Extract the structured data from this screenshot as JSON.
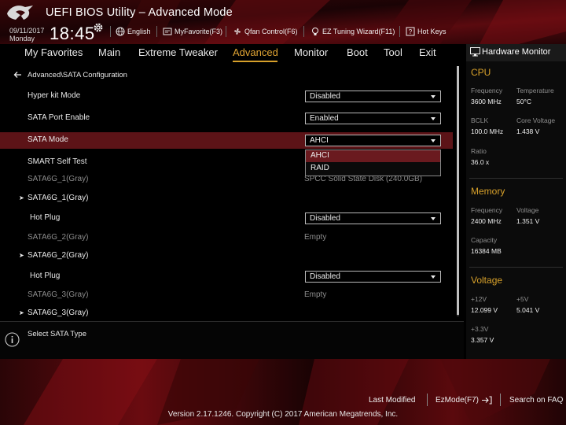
{
  "app": {
    "title": "UEFI BIOS Utility – Advanced Mode",
    "date": "09/11/2017",
    "day": "Monday",
    "time": "18:45"
  },
  "toolbar": {
    "language": "English",
    "myfavorite": "MyFavorite(F3)",
    "qfan": "Qfan Control(F6)",
    "ez_tuning": "EZ Tuning Wizard(F11)",
    "hotkeys": "Hot Keys"
  },
  "nav": {
    "tabs": [
      {
        "label": "My Favorites"
      },
      {
        "label": "Main"
      },
      {
        "label": "Extreme Tweaker"
      },
      {
        "label": "Advanced"
      },
      {
        "label": "Monitor"
      },
      {
        "label": "Boot"
      },
      {
        "label": "Tool"
      },
      {
        "label": "Exit"
      }
    ],
    "active_tab": "Advanced"
  },
  "breadcrumb": "Advanced\\SATA Configuration",
  "settings": {
    "hyper_kit_mode": {
      "label": "Hyper kit Mode",
      "value": "Disabled"
    },
    "sata_port_enable": {
      "label": "SATA Port Enable",
      "value": "Enabled"
    },
    "sata_mode": {
      "label": "SATA Mode",
      "value": "AHCI",
      "options": [
        "AHCI",
        "RAID"
      ]
    },
    "smart_self_test": {
      "label": "SMART Self Test"
    },
    "sata6g_1_info": {
      "label": "SATA6G_1(Gray)",
      "value": "SPCC Solid State Disk (240.0GB)"
    },
    "sata6g_1_sub": {
      "label": "SATA6G_1(Gray)"
    },
    "hot_plug_1": {
      "label": "Hot Plug",
      "value": "Disabled"
    },
    "sata6g_2_info": {
      "label": "SATA6G_2(Gray)",
      "value": "Empty"
    },
    "sata6g_2_sub": {
      "label": "SATA6G_2(Gray)"
    },
    "hot_plug_2": {
      "label": "Hot Plug",
      "value": "Disabled"
    },
    "sata6g_3_info": {
      "label": "SATA6G_3(Gray)",
      "value": "Empty"
    },
    "sata6g_3_sub": {
      "label": "SATA6G_3(Gray)"
    }
  },
  "info": {
    "text": "Select SATA Type"
  },
  "hardware_monitor": {
    "title": "Hardware Monitor",
    "cpu": {
      "heading": "CPU",
      "frequency_label": "Frequency",
      "frequency": "3600 MHz",
      "temperature_label": "Temperature",
      "temperature": "50°C",
      "bclk_label": "BCLK",
      "bclk": "100.0 MHz",
      "core_voltage_label": "Core Voltage",
      "core_voltage": "1.438 V",
      "ratio_label": "Ratio",
      "ratio": "36.0 x"
    },
    "memory": {
      "heading": "Memory",
      "frequency_label": "Frequency",
      "frequency": "2400 MHz",
      "voltage_label": "Voltage",
      "voltage": "1.351 V",
      "capacity_label": "Capacity",
      "capacity": "16384 MB"
    },
    "voltage": {
      "heading": "Voltage",
      "v12_label": "+12V",
      "v12": "12.099 V",
      "v5_label": "+5V",
      "v5": "5.041 V",
      "v33_label": "+3.3V",
      "v33": "3.357 V"
    }
  },
  "footer": {
    "last_modified": "Last Modified",
    "ezmode": "EzMode(F7)",
    "search": "Search on FAQ",
    "version": "Version 2.17.1246. Copyright (C) 2017 American Megatrends, Inc."
  },
  "colors": {
    "accent": "#d7a02a",
    "selected_row": "#5c1317",
    "background": "#000000"
  },
  "icons": [
    "rog-logo-icon",
    "gear-icon",
    "globe-icon",
    "favorite-icon",
    "fan-icon",
    "bulb-icon",
    "help-icon",
    "back-arrow-icon",
    "chevron-right-icon",
    "info-icon",
    "monitor-icon",
    "exit-arrow-icon"
  ]
}
